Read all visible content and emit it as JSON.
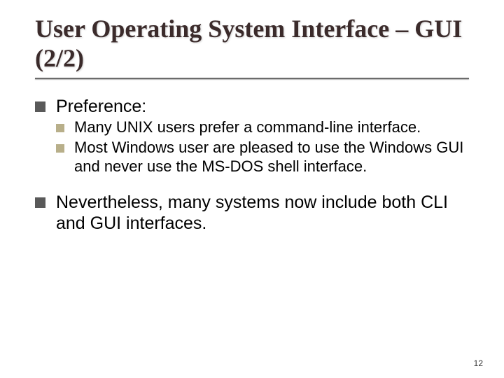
{
  "title": "User Operating System Interface – GUI (2/2)",
  "bullets": {
    "preference": {
      "label": "Preference:",
      "items": [
        "Many UNIX users prefer a command-line interface.",
        "Most Windows user are pleased to use the Windows GUI and never use the MS-DOS shell interface."
      ]
    },
    "nevertheless": "Nevertheless, many systems now include both CLI and GUI interfaces."
  },
  "slide_number": "12"
}
